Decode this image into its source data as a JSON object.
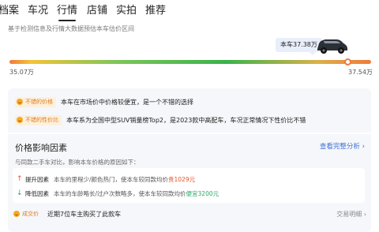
{
  "tabs": [
    {
      "label": "档案",
      "active": false
    },
    {
      "label": "车况",
      "active": false
    },
    {
      "label": "行情",
      "active": true
    },
    {
      "label": "店铺",
      "active": false
    },
    {
      "label": "实拍",
      "active": false
    },
    {
      "label": "推荐",
      "active": false
    }
  ],
  "valuation": {
    "subtitle": "基于检测信息及行情大数据预估本车估价区间",
    "current_label": "本车37.38万",
    "current_value": 37.38,
    "min_label": "35.07万",
    "min_value": 35.07,
    "max_label": "37.54万",
    "max_value": 37.54
  },
  "evaluations": [
    {
      "tag": "不错的价格",
      "icon": "smile-icon",
      "text": "本车在市场价中价格较便宜，是一个不错的选择"
    },
    {
      "tag": "不错的性价比",
      "icon": "smile-icon",
      "text": "本车系为全国中型SUV销量榜Top2，是2023款中高配车，车况正常情况下性价比不错"
    }
  ],
  "factors": {
    "title": "价格影响因素",
    "more_link": "查看完整分析 ›",
    "description": "与同款二手车对比，影响本车价格的原因如下：",
    "items": [
      {
        "arrow": "↑",
        "name": "提升因素",
        "desc": "本车的里程少/颜色热门，使本车较同款均价",
        "highlight": "贵1029元",
        "direction": "up"
      },
      {
        "arrow": "↓",
        "name": "降低因素",
        "desc": "本车的车龄略长/过户次数略多，使本车较同款均价",
        "highlight": "便宜3200元",
        "direction": "down"
      }
    ]
  },
  "deal": {
    "tag": "成交价",
    "text": "近期7位车主购买了此款车",
    "link": "交易明细 ›"
  },
  "colors": {
    "accent_orange": "#f07a3a",
    "link_blue": "#3b6fd6",
    "up_red": "#e2552d",
    "down_green": "#2aa865"
  }
}
